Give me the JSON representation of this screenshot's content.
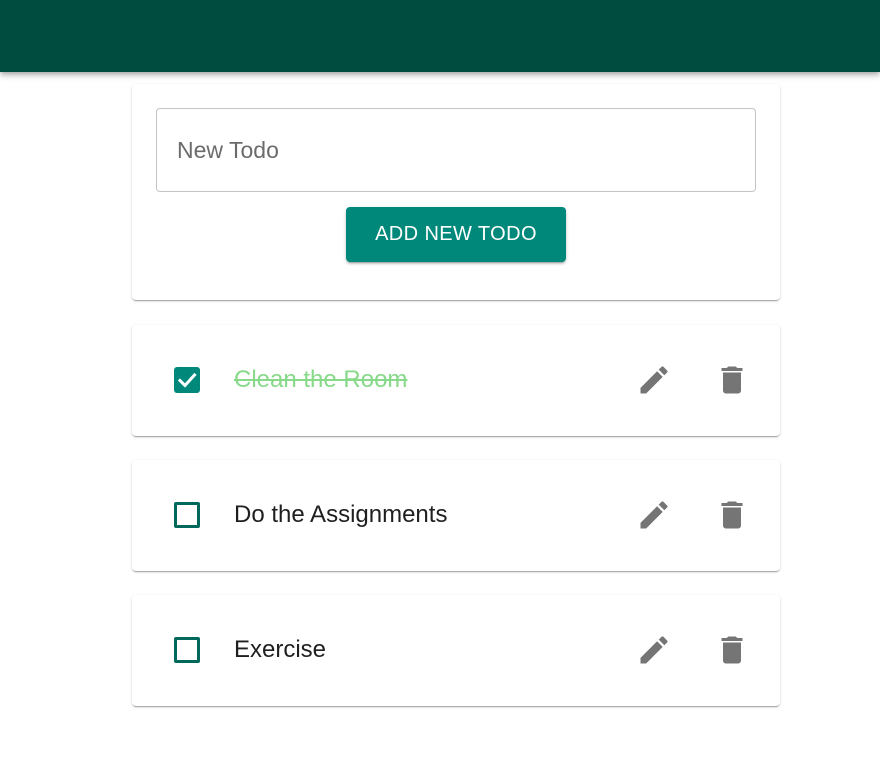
{
  "form": {
    "input_value": "",
    "input_placeholder": "New Todo",
    "add_button_label": "ADD NEW TODO"
  },
  "todos": [
    {
      "text": "Clean the Room",
      "completed": true
    },
    {
      "text": "Do the Assignments",
      "completed": false
    },
    {
      "text": "Exercise",
      "completed": false
    }
  ],
  "icons": {
    "edit": "pencil-icon",
    "delete": "trash-icon",
    "check": "checkmark-icon"
  },
  "colors": {
    "app_bar": "#004d40",
    "accent": "#00897b",
    "checkbox_border": "#00695c",
    "completed_text": "#88d98a",
    "icon": "#757575"
  }
}
